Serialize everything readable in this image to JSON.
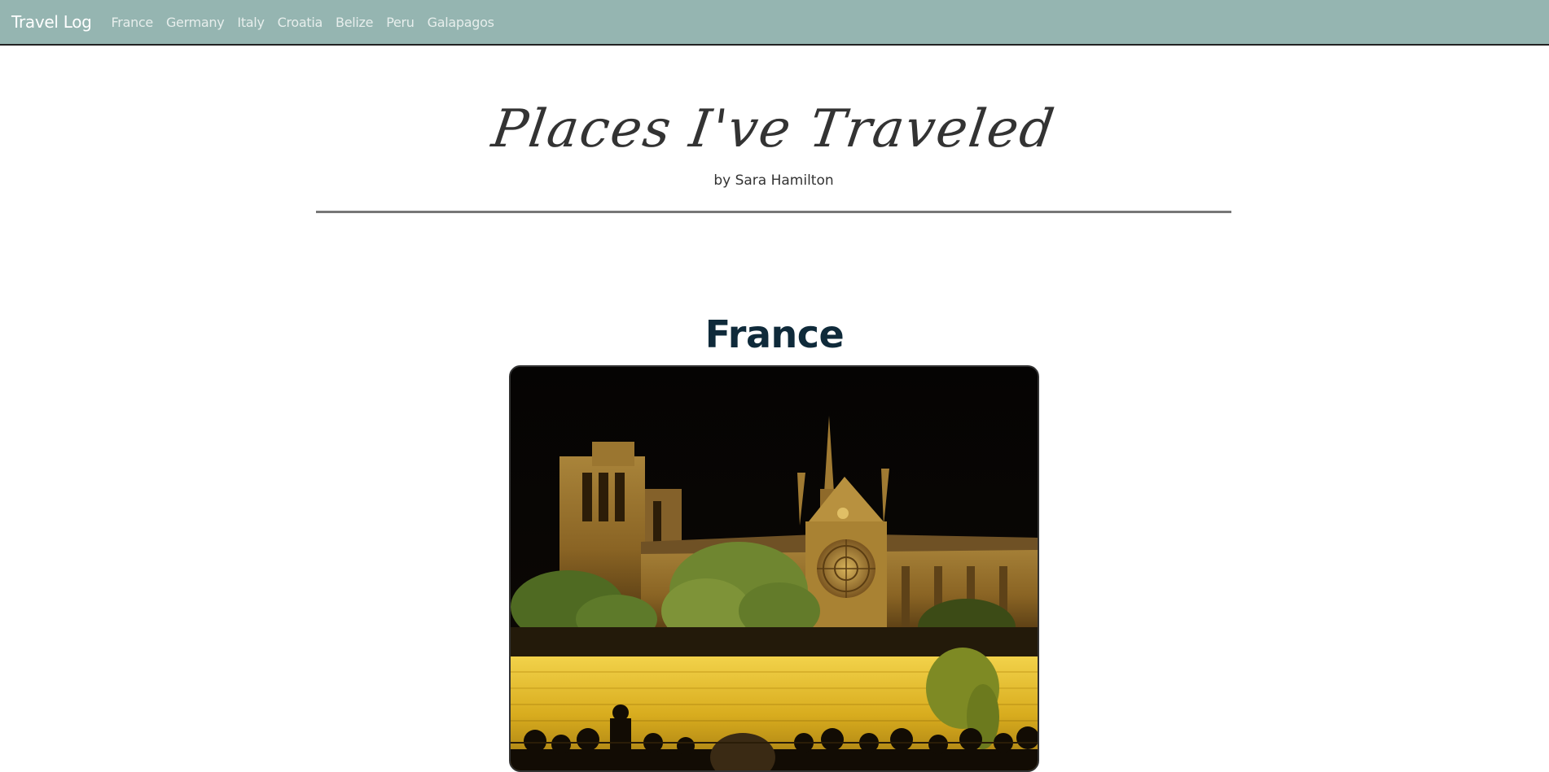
{
  "navbar": {
    "brand": "Travel Log",
    "links": [
      "France",
      "Germany",
      "Italy",
      "Croatia",
      "Belize",
      "Peru",
      "Galapagos"
    ]
  },
  "header": {
    "title": "Places I've Traveled",
    "byline": "by Sara Hamilton"
  },
  "sections": [
    {
      "title": "France",
      "photo_subject": "notre-dame-cathedral-at-night"
    }
  ],
  "colors": {
    "navbar_bg": "#95b5b1",
    "section_title": "#0f2a3a",
    "rule": "#777777"
  }
}
